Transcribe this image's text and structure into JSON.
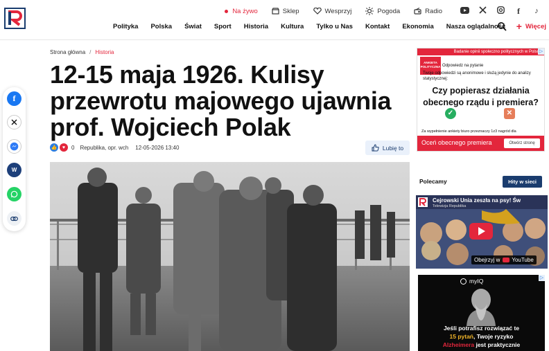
{
  "header": {
    "logo_alt": "R",
    "top_links": [
      {
        "label": "Na żywo",
        "icon": "live-dot"
      },
      {
        "label": "Sklep",
        "icon": "shop-icon"
      },
      {
        "label": "Wesprzyj",
        "icon": "heart-icon"
      },
      {
        "label": "Pogoda",
        "icon": "sun-icon"
      },
      {
        "label": "Radio",
        "icon": "radio-icon"
      }
    ],
    "social": [
      "youtube-icon",
      "x-icon",
      "instagram-icon",
      "facebook-icon",
      "tiktok-icon"
    ],
    "nav": [
      "Polityka",
      "Polska",
      "Świat",
      "Sport",
      "Historia",
      "Kultura",
      "Tylko u Nas",
      "Kontakt",
      "Ekonomia",
      "Nasza oglądalność"
    ],
    "more_label": "Więcej"
  },
  "share": [
    "facebook-icon",
    "x-icon",
    "messenger-icon",
    "wykop-icon",
    "whatsapp-icon",
    "link-icon"
  ],
  "article": {
    "breadcrumb": [
      "Strona główna",
      "Historia"
    ],
    "title": "12-15 maja 1926. Kulisy przewrotu majowego ujawnia prof. Wojciech Polak",
    "reactions": "0",
    "author": "Republika, opr. wch",
    "date": "12-05-2026 13:40",
    "like_label": "Lubię to"
  },
  "ad_poll": {
    "top": "Badanie opinii społeczno politycznych w Polsce",
    "badge": "ANKIETA POLITYCZNA",
    "head": "Odpowiedz na pytanie",
    "body": "Twoje odpowiedzi są anonimowe i służą jedynie do analizy statystycznej:",
    "question": "Czy popierasz działania obecnego rządu i premiera?",
    "foot": "Za wypełnienie ankiety biuro przeznaczy 1z3 nagród dla",
    "bar_text": "Oceń obecnego premiera",
    "bar_button": "Otwórz stronę"
  },
  "recs": {
    "title": "Polecamy",
    "button": "Hity w sieci"
  },
  "video": {
    "title": "Cejrowski Unia zeszła na psy! Św",
    "channel": "Telewizja Republika",
    "watch_label": "Obejrzyj w",
    "yt_label": "YouTube"
  },
  "ad_iq": {
    "brand": "myIQ",
    "line1": "Jeśli potrafisz rozwiązać te",
    "line2_hl": "15 pytań",
    "line2_rest": ", Twoje ryzyko",
    "line3_rd": "Alzheimera",
    "line3_rest": " jest praktycznie"
  }
}
